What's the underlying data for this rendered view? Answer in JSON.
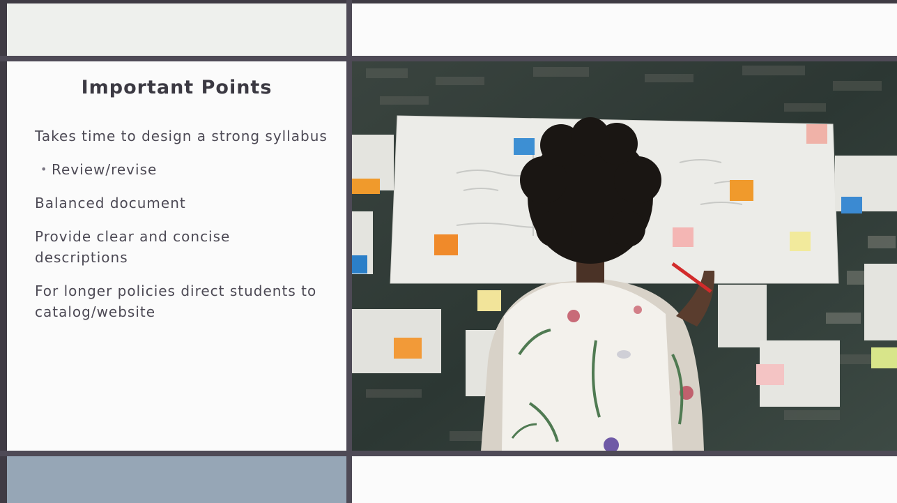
{
  "slide": {
    "title": "Important Points",
    "points": [
      {
        "text": "Takes time to design a strong syllabus",
        "level": 0
      },
      {
        "text": "Review/revise",
        "level": 1
      },
      {
        "text": "Balanced document",
        "level": 0
      },
      {
        "text": "Provide clear and concise descriptions",
        "level": 0
      },
      {
        "text": "For longer policies direct students to catalog/website",
        "level": 0
      }
    ],
    "bullet_glyph": "•"
  },
  "colors": {
    "frame_dark": "#4e4a56",
    "accent_blue_gray": "#96a6b6",
    "pane_light": "#fbfbfb",
    "text": "#4d4a55"
  }
}
